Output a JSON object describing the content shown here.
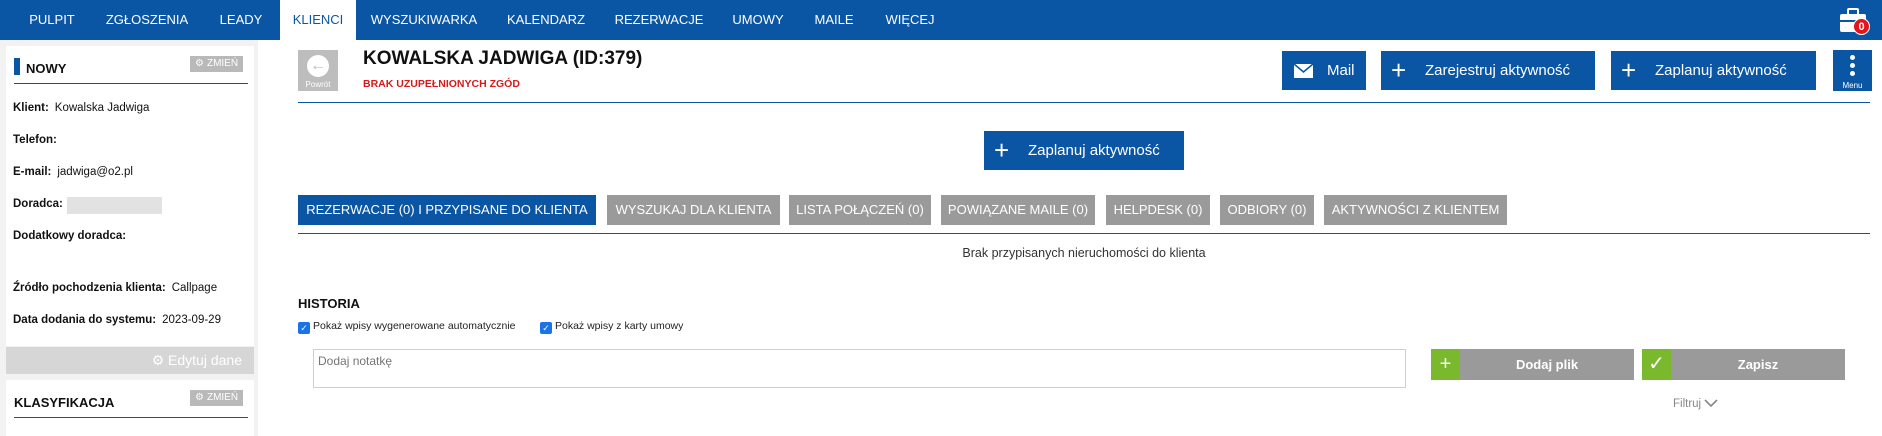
{
  "nav": {
    "items": [
      "PULPIT",
      "ZGŁOSZENIA",
      "LEADY",
      "KLIENCI",
      "WYSZUKIWARKA",
      "KALENDARZ",
      "REZERWACJE",
      "UMOWY",
      "MAILE",
      "WIĘCEJ"
    ],
    "active": "KLIENCI",
    "briefcase_count": "0"
  },
  "sidebar": {
    "status_title": "NOWY",
    "change_label": "ZMIEŃ",
    "fields": [
      {
        "label": "Klient:",
        "value": "Kowalska Jadwiga"
      },
      {
        "label": "Telefon:",
        "value": ""
      },
      {
        "label": "E-mail:",
        "value": "jadwiga@o2.pl"
      },
      {
        "label": "Doradca:",
        "value": ""
      },
      {
        "label": "Dodatkowy doradca:",
        "value": ""
      },
      {
        "label": "Źródło pochodzenia klienta:",
        "value": "Callpage"
      },
      {
        "label": "Data dodania do systemu:",
        "value": "2023-09-29"
      }
    ],
    "edit_label": "Edytuj dane",
    "classification_title": "KLASYFIKACJA",
    "classification_change_label": "ZMIEŃ"
  },
  "header": {
    "back_label": "Powrót",
    "client_title": "KOWALSKA JADWIGA (ID:379)",
    "consent_warning": "BRAK UZUPEŁNIONYCH ZGÓD",
    "mail_label": "Mail",
    "register_label": "Zarejestruj aktywność",
    "plan_label": "Zaplanuj aktywność",
    "menu_label": "Menu"
  },
  "main": {
    "plan_center_label": "Zaplanuj aktywność",
    "tabs": [
      "REZERWACJE (0) I PRZYPISANE DO KLIENTA",
      "WYSZUKAJ DLA KLIENTA",
      "LISTA POŁĄCZEŃ (0)",
      "POWIĄZANE MAILE (0)",
      "HELPDESK (0)",
      "ODBIORY (0)",
      "AKTYWNOŚCI Z KLIENTEM"
    ],
    "no_properties": "Brak przypisanych nieruchomości do klienta"
  },
  "history": {
    "title": "HISTORIA",
    "checkbox_auto": "Pokaż wpisy wygenerowane automatycznie",
    "checkbox_contract": "Pokaż wpisy z karty umowy",
    "note_placeholder": "Dodaj notatkę",
    "add_file_label": "Dodaj plik",
    "save_label": "Zapisz",
    "filter_label": "Filtruj"
  },
  "colors": {
    "brand_blue": "#0a56a4",
    "tab_gray": "#9a9a9a",
    "accent_green": "#7ab92d",
    "warning_red": "#d61a1a"
  }
}
